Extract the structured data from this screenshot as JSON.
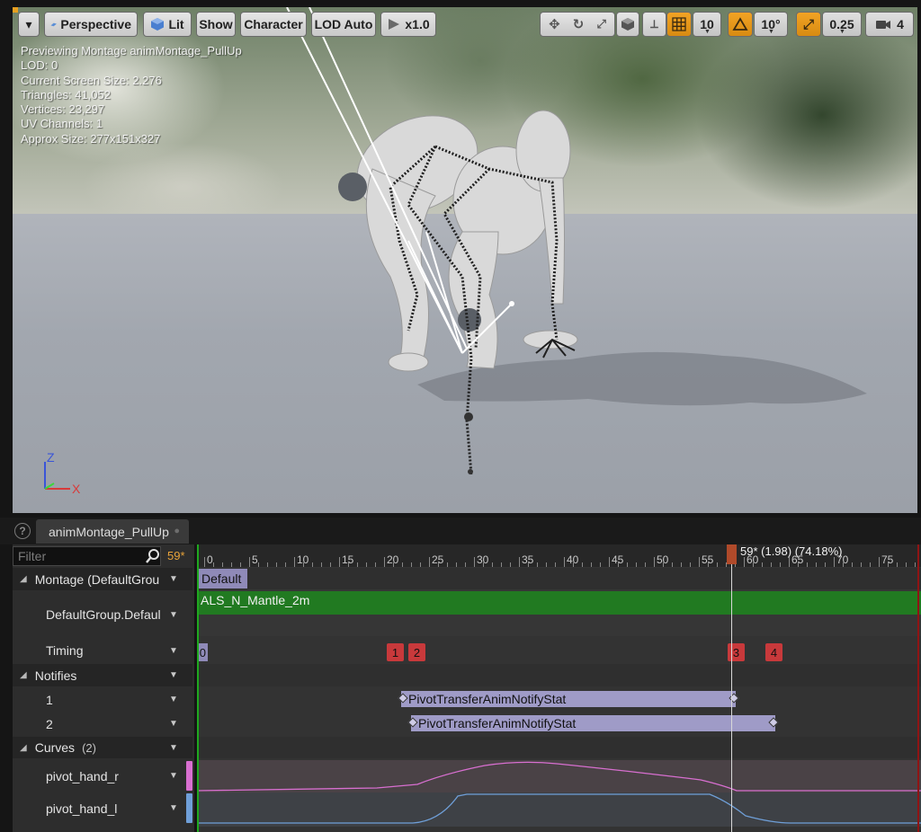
{
  "toolbar": {
    "menu_caret": "▾",
    "perspective": "Perspective",
    "lit": "Lit",
    "show": "Show",
    "character": "Character",
    "lod": "LOD Auto",
    "speed": "x1.0",
    "grid_snap": "10",
    "rot_snap": "10°",
    "scale_snap": "0.25",
    "camera_speed": "4"
  },
  "stats": {
    "line1": "Previewing Montage animMontage_PullUp",
    "line2": "LOD: 0",
    "line3": "Current Screen Size: 2.276",
    "line4": "Triangles: 41,052",
    "line5": "Vertices: 23,297",
    "line6": "UV Channels: 1",
    "line7": "Approx Size: 277x151x327"
  },
  "axis": {
    "z": "Z",
    "x": "X"
  },
  "tab": {
    "label": "animMontage_PullUp"
  },
  "filter": {
    "placeholder": "Filter"
  },
  "current_frame": "59*",
  "rows": {
    "montage": "Montage (DefaultGrou",
    "default_group": "DefaultGroup.Defaul",
    "timing": "Timing",
    "notifies": "Notifies",
    "notify1": "1",
    "notify2": "2",
    "curves": "Curves",
    "curves_count": "(2)",
    "curve_r": "pivot_hand_r",
    "curve_l": "pivot_hand_l"
  },
  "timeline": {
    "ticks": [
      "0",
      "5",
      "10",
      "15",
      "20",
      "25",
      "30",
      "35",
      "40",
      "45",
      "50",
      "55",
      "60",
      "65",
      "70",
      "75"
    ],
    "playhead_label": "59* (1.98) (74.18%)",
    "slot_default": "Default",
    "anim_segment": "ALS_N_Mantle_2m",
    "timing_zero": "0",
    "sections": [
      "1",
      "2",
      "3",
      "4"
    ],
    "notify_bar_1": "PivotTransferAnimNotifyStat",
    "notify_bar_2": "PivotTransferAnimNotifyStat"
  },
  "colors": {
    "accent_orange": "#e7a020",
    "curve_r": "#d86fd0",
    "curve_l": "#6f9fd8",
    "anim_green": "#217a21",
    "notify_purple": "#9f9bc7",
    "section_red": "#c8393b"
  },
  "icons": {
    "menu": "chevron-down-icon",
    "perspective": "perspective-icon",
    "lit": "lit-cube-icon",
    "speed": "play-icon",
    "translate": "translate-icon",
    "rotate": "rotate-icon",
    "scale": "scale-icon",
    "surface": "surface-snap-icon",
    "world": "world-icon",
    "grid": "grid-icon",
    "angle": "angle-icon",
    "scale_snap": "scale-snap-icon",
    "camera": "camera-speed-icon",
    "help": "help-icon",
    "search": "search-icon"
  }
}
